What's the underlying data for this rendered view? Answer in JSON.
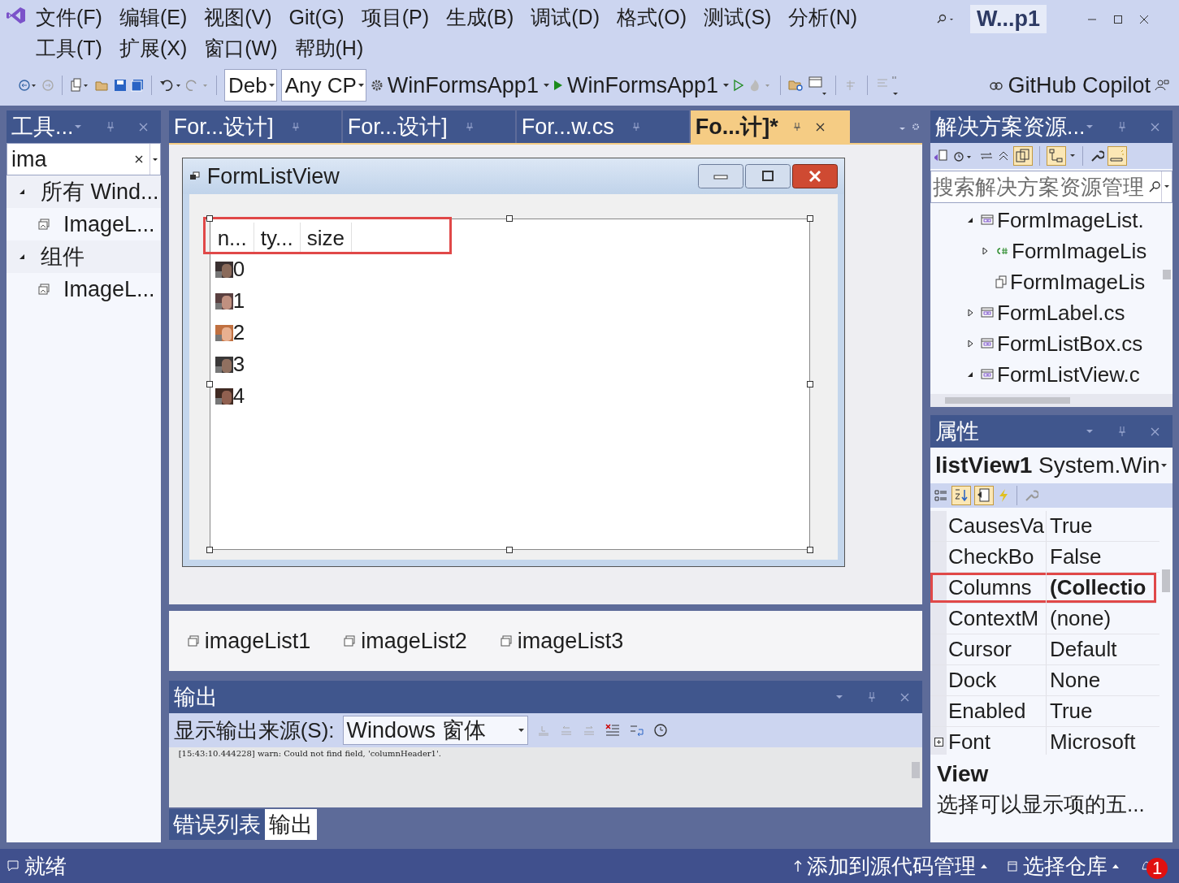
{
  "menu": [
    "文件(F)",
    "编辑(E)",
    "视图(V)",
    "Git(G)",
    "项目(P)",
    "生成(B)",
    "调试(D)",
    "格式(O)",
    "测试(S)",
    "分析(N)",
    "工具(T)",
    "扩展(X)",
    "窗口(W)",
    "帮助(H)"
  ],
  "title_badge": "W...p1",
  "toolbar": {
    "configuration": "Deb",
    "platform": "Any CP",
    "startup_project": "WinFormsApp1",
    "run_target": "WinFormsApp1",
    "copilot": "GitHub Copilot"
  },
  "toolbox": {
    "title": "工具...",
    "search": "ima",
    "groups": [
      {
        "label": "所有 Wind...",
        "expanded": true,
        "children": [
          {
            "label": "ImageL..."
          }
        ]
      },
      {
        "label": "组件",
        "expanded": true,
        "children": [
          {
            "label": "ImageL..."
          }
        ]
      }
    ]
  },
  "tabs": [
    {
      "label": "For...设计]",
      "selected": false
    },
    {
      "label": "For...设计]",
      "selected": false
    },
    {
      "label": "For...w.cs",
      "selected": false
    },
    {
      "label": "Fo...计]*",
      "selected": true
    }
  ],
  "form": {
    "title": "FormListView",
    "header_highlighted": true,
    "columns": [
      "n...",
      "ty...",
      "size"
    ],
    "items": [
      {
        "label": "0"
      },
      {
        "label": "1"
      },
      {
        "label": "2"
      },
      {
        "label": "3"
      },
      {
        "label": "4"
      }
    ]
  },
  "component_tray": [
    "imageList1",
    "imageList2",
    "imageList3"
  ],
  "output": {
    "title": "输出",
    "source_label": "显示输出来源(S):",
    "source": "Windows 窗体",
    "lines": [
      "[15:43:10.444228] warn: Could not find field, 'columnHeader1'."
    ]
  },
  "bottom_tabs": [
    {
      "label": "错误列表",
      "selected": false
    },
    {
      "label": "输出",
      "selected": true
    }
  ],
  "solution": {
    "title": "解决方案资源...",
    "search_placeholder": "搜索解决方案资源管理",
    "tree": [
      {
        "label": "FormImageList.",
        "kind": "form",
        "expanded": true,
        "children": [
          {
            "label": "FormImageLis",
            "kind": "csharp",
            "expanded": false
          },
          {
            "label": "FormImageLis",
            "kind": "resource"
          }
        ]
      },
      {
        "label": "FormLabel.cs",
        "kind": "form",
        "expanded": false
      },
      {
        "label": "FormListBox.cs",
        "kind": "form",
        "expanded": false
      },
      {
        "label": "FormListView.c",
        "kind": "form",
        "expanded": true
      }
    ]
  },
  "properties": {
    "title": "属性",
    "object": "listView1",
    "type": "System.Win",
    "rows": [
      {
        "name": "CausesVa",
        "value": "True",
        "bold": false,
        "highlighted": false,
        "expandable": false
      },
      {
        "name": "CheckBo",
        "value": "False",
        "bold": false,
        "highlighted": false,
        "expandable": false
      },
      {
        "name": "Columns",
        "value": "(Collectio",
        "bold": true,
        "highlighted": true,
        "expandable": false
      },
      {
        "name": "ContextM",
        "value": "(none)",
        "bold": false,
        "highlighted": false,
        "expandable": false
      },
      {
        "name": "Cursor",
        "value": "Default",
        "bold": false,
        "highlighted": false,
        "expandable": false
      },
      {
        "name": "Dock",
        "value": "None",
        "bold": false,
        "highlighted": false,
        "expandable": false
      },
      {
        "name": "Enabled",
        "value": "True",
        "bold": false,
        "highlighted": false,
        "expandable": false
      },
      {
        "name": "Font",
        "value": "Microsoft",
        "bold": false,
        "highlighted": false,
        "expandable": true
      }
    ],
    "description_title": "View",
    "description": "选择可以显示项的五..."
  },
  "status": {
    "text": "就绪",
    "source_control": "添加到源代码管理",
    "repository": "选择仓库",
    "notifications": "1"
  }
}
